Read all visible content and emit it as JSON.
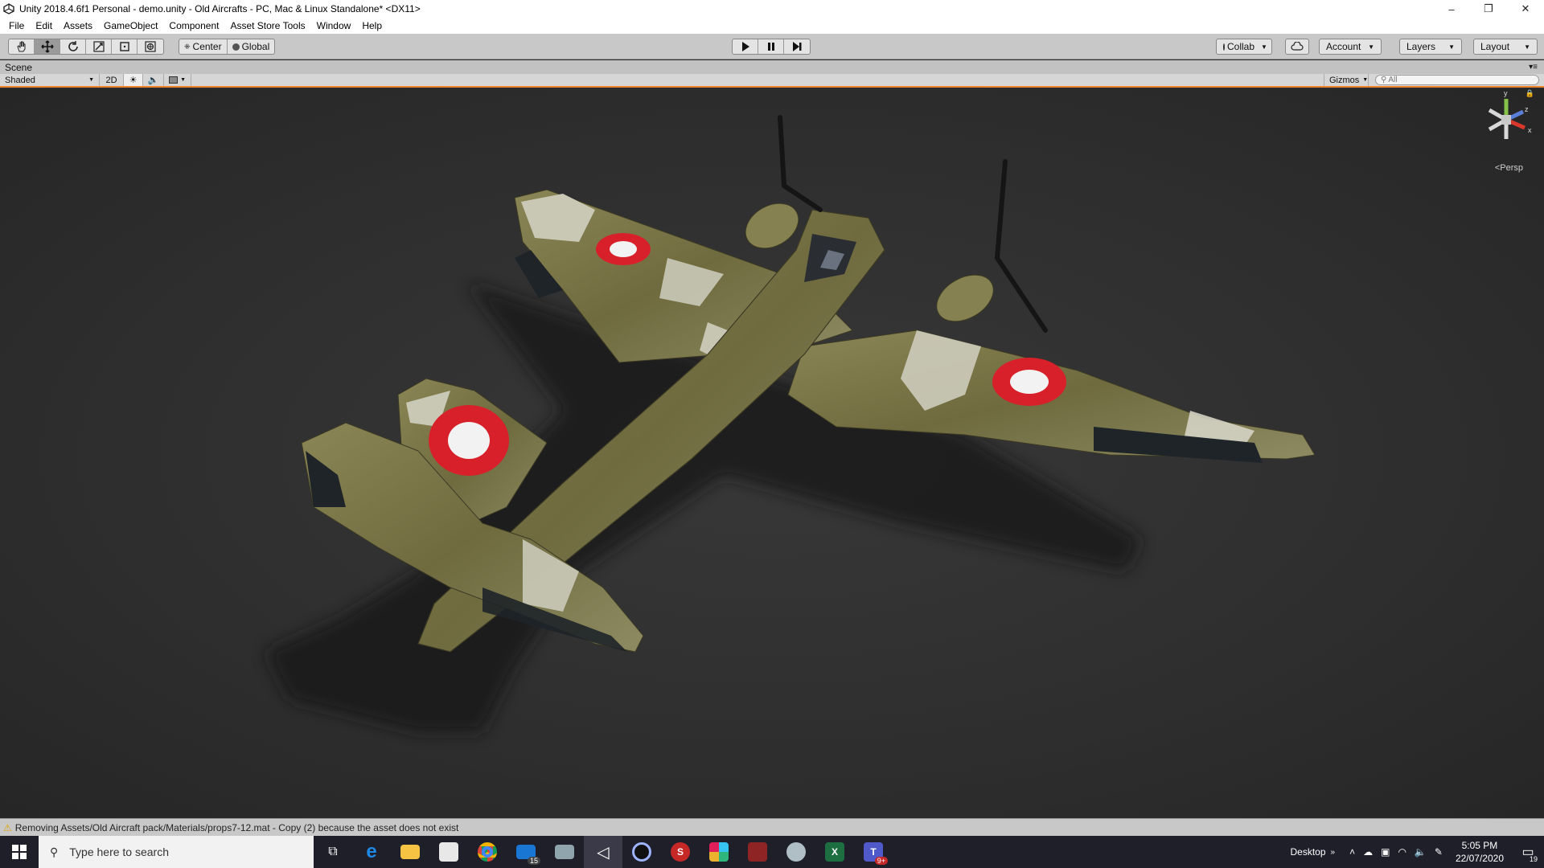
{
  "window": {
    "title": "Unity 2018.4.6f1 Personal - demo.unity - Old Aircrafts - PC, Mac & Linux Standalone* <DX11>",
    "minimize": "–",
    "restore": "❐",
    "close": "✕"
  },
  "menu": [
    "File",
    "Edit",
    "Assets",
    "GameObject",
    "Component",
    "Asset Store Tools",
    "Window",
    "Help"
  ],
  "toolbar": {
    "tools": [
      "hand-tool",
      "move-tool",
      "rotate-tool",
      "scale-tool",
      "rect-tool",
      "transform-tool"
    ],
    "pivot_center": "Center",
    "pivot_global": "Global",
    "collab": "Collab",
    "account": "Account",
    "layers": "Layers",
    "layout": "Layout"
  },
  "scene": {
    "tab_label": "Scene",
    "shading_mode": "Shaded",
    "mode_2d": "2D",
    "gizmos_label": "Gizmos",
    "search_placeholder": "All",
    "projection": "Persp",
    "axis_y": "y",
    "axis_z": "z",
    "axis_x": "x"
  },
  "status": {
    "message": "Removing Assets/Old Aircraft pack/Materials/props7-12.mat - Copy (2) because the asset does not exist"
  },
  "taskbar": {
    "search_placeholder": "Type here to search",
    "mail_badge": "15",
    "teams_badge": "9+",
    "desktop_label": "Desktop",
    "time": "5:05 PM",
    "date": "22/07/2020",
    "notification_count": "19"
  },
  "colors": {
    "accent_orange": "#f0862c",
    "roundel_red": "#d8202a",
    "camo_olive": "#7d7a4a"
  }
}
